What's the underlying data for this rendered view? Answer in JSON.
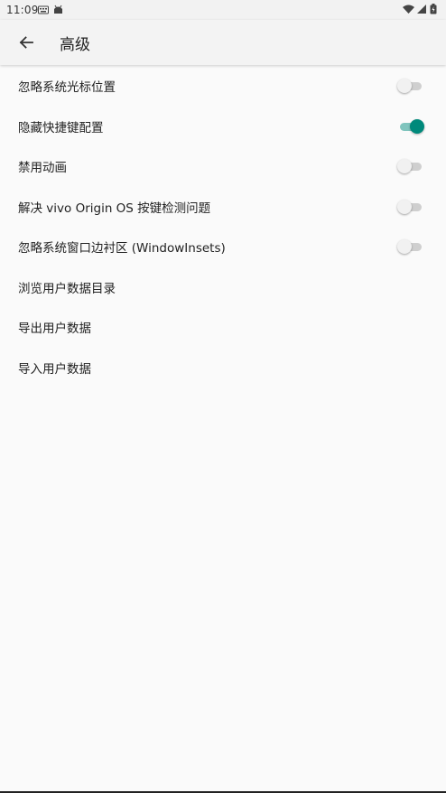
{
  "status_bar": {
    "time": "11:09",
    "notification_icons": [
      "keyboard-icon",
      "android-icon"
    ],
    "system_icons": [
      "wifi-icon",
      "signal-icon",
      "battery-icon"
    ]
  },
  "app_bar": {
    "title": "高级",
    "back_icon": "arrow-back-icon"
  },
  "accent_color": "#00897b",
  "settings": [
    {
      "label": "忽略系统光标位置",
      "toggle": true,
      "checked": false
    },
    {
      "label": "隐藏快捷键配置",
      "toggle": true,
      "checked": true
    },
    {
      "label": "禁用动画",
      "toggle": true,
      "checked": false
    },
    {
      "label": "解决 vivo Origin OS 按键检测问题",
      "toggle": true,
      "checked": false
    },
    {
      "label": "忽略系统窗口边衬区 (WindowInsets)",
      "toggle": true,
      "checked": false
    },
    {
      "label": "浏览用户数据目录",
      "toggle": false
    },
    {
      "label": "导出用户数据",
      "toggle": false
    },
    {
      "label": "导入用户数据",
      "toggle": false
    }
  ]
}
